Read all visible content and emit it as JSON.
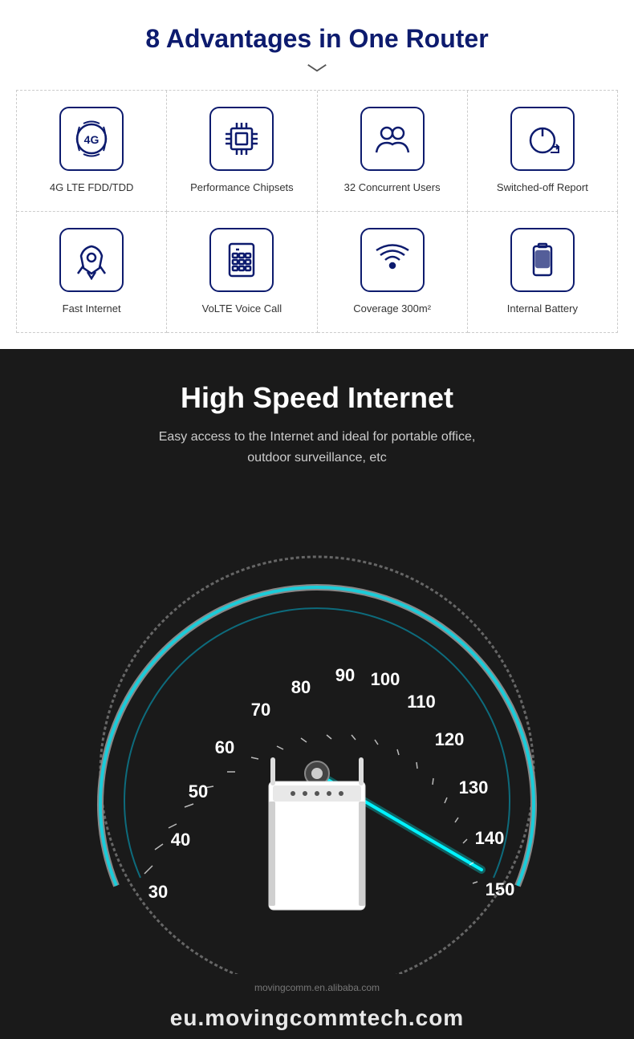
{
  "advantages": {
    "title": "8 Advantages in One Router",
    "items": [
      {
        "id": "4g-lte",
        "label": "4G LTE FDD/TDD",
        "icon": "4g"
      },
      {
        "id": "chipset",
        "label": "Performance Chipsets",
        "icon": "chip"
      },
      {
        "id": "users",
        "label": "32 Concurrent Users",
        "icon": "users"
      },
      {
        "id": "switched-off",
        "label": "Switched-off Report",
        "icon": "power"
      },
      {
        "id": "fast-internet",
        "label": "Fast Internet",
        "icon": "rocket"
      },
      {
        "id": "volte",
        "label": "VoLTE Voice Call",
        "icon": "phone"
      },
      {
        "id": "coverage",
        "label": "Coverage 300m²",
        "icon": "wifi"
      },
      {
        "id": "battery",
        "label": "Internal Battery",
        "icon": "battery"
      }
    ]
  },
  "speed_section": {
    "title": "High Speed Internet",
    "subtitle_line1": "Easy access to the Internet and ideal for portable office,",
    "subtitle_line2": "outdoor surveillance, etc",
    "speedometer_labels": [
      "30",
      "40",
      "50",
      "60",
      "70",
      "80",
      "90",
      "100",
      "110",
      "120",
      "130",
      "140",
      "150"
    ],
    "needle_value": 150,
    "website": "eu.movingcommtech.com",
    "website_small": "movingcomm.en.alibaba.com"
  }
}
